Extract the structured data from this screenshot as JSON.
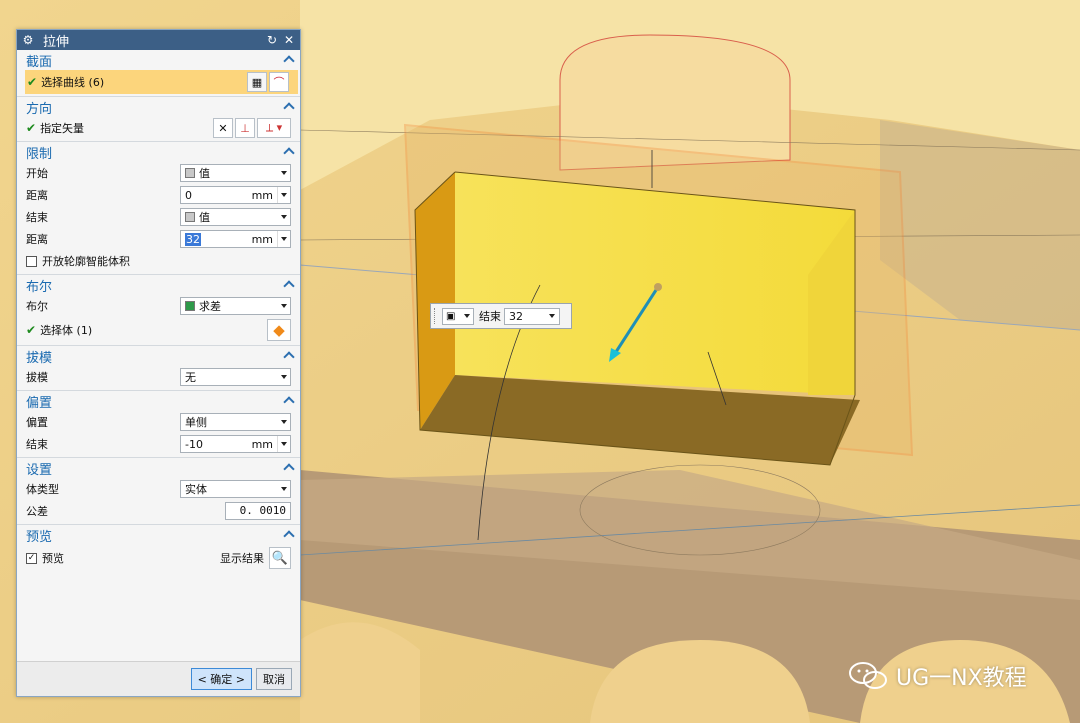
{
  "dialog": {
    "title": "拉伸",
    "sections": {
      "section": {
        "header": "截面",
        "select_curve": "选择曲线 (6)"
      },
      "direction": {
        "header": "方向",
        "specify_vector": "指定矢量"
      },
      "limits": {
        "header": "限制",
        "start_label": "开始",
        "start_value": "值",
        "distance1_label": "距离",
        "distance1_value": "0",
        "distance1_unit": "mm",
        "end_label": "结束",
        "end_value": "值",
        "distance2_label": "距离",
        "distance2_value": "32",
        "distance2_unit": "mm",
        "open_profile": "开放轮廓智能体积"
      },
      "boolean": {
        "header": "布尔",
        "boolean_label": "布尔",
        "boolean_value": "求差",
        "select_body": "选择体 (1)"
      },
      "draft": {
        "header": "拔模",
        "draft_label": "拔模",
        "draft_value": "无"
      },
      "offset": {
        "header": "偏置",
        "offset_label": "偏置",
        "offset_value": "单侧",
        "end_label": "结束",
        "end_value": "-10",
        "end_unit": "mm"
      },
      "settings": {
        "header": "设置",
        "body_type_label": "体类型",
        "body_type_value": "实体",
        "tolerance_label": "公差",
        "tolerance_value": "0. 0010"
      },
      "preview": {
        "header": "预览",
        "preview_label": "预览",
        "show_result": "显示结果"
      }
    },
    "ok_label": "< 确定 >",
    "cancel_label": "取消"
  },
  "float_widget": {
    "label": "结束",
    "value": "32"
  },
  "watermark": {
    "text": "UG一NX教程"
  },
  "colors": {
    "title_bar": "#3c5f86",
    "section_header": "#1a6ab0",
    "highlight_row": "#fcd57c",
    "extrude_body": "#f4de3c",
    "model_surface": "#f3d98e"
  },
  "icons": [
    "gear-icon",
    "reset-icon",
    "close-icon",
    "check-icon",
    "curve-icon",
    "vector-icon",
    "cube-icon",
    "magnifier-icon",
    "wechat-icon"
  ]
}
